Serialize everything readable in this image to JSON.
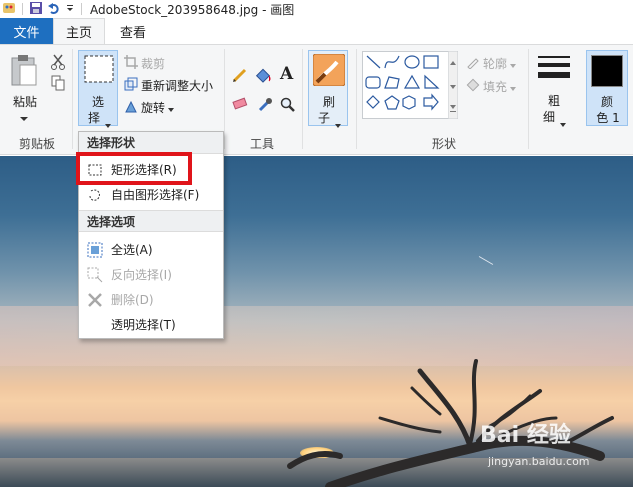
{
  "window": {
    "title": "AdobeStock_203958648.jpg - 画图"
  },
  "tabs": {
    "file": "文件",
    "home": "主页",
    "view": "查看"
  },
  "ribbon": {
    "clipboard": {
      "paste": "粘贴",
      "label": "剪贴板"
    },
    "image": {
      "select_line1": "选",
      "select_line2": "择",
      "crop": "裁剪",
      "resize": "重新调整大小",
      "rotate": "旋转"
    },
    "tools": {
      "label": "工具"
    },
    "brush": {
      "line1": "刷",
      "line2": "子"
    },
    "shapes": {
      "outline": "轮廓",
      "fill": "填充",
      "label": "形状"
    },
    "size": {
      "line1": "粗",
      "line2": "细"
    },
    "color": {
      "line1": "颜",
      "line2": "色 1"
    }
  },
  "select_menu": {
    "section_shape": "选择形状",
    "rect": "矩形选择(R)",
    "freeform": "自由图形选择(F)",
    "section_options": "选择选项",
    "select_all": "全选(A)",
    "invert": "反向选择(I)",
    "delete": "删除(D)",
    "transparent": "透明选择(T)"
  },
  "watermark": {
    "logo": "Bai 经验",
    "sub": "jingyan.baidu.com"
  },
  "colors": {
    "accent": "#1e6fc0",
    "highlight": "#e0141a",
    "color1": "#000000"
  }
}
